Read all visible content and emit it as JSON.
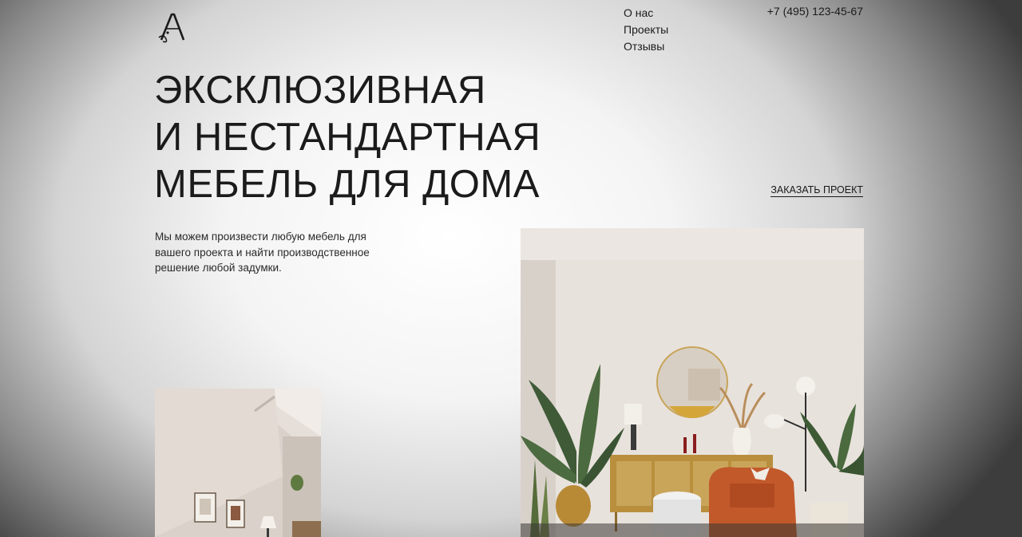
{
  "logo": {
    "letter": "A",
    "icon": "logo-monogram"
  },
  "nav": {
    "items": [
      "О нас",
      "Проекты",
      "Отзывы"
    ]
  },
  "header": {
    "phone": "+7 (495) 123-45-67"
  },
  "hero": {
    "title_lines": [
      "ЭКСКЛЮЗИВНАЯ",
      "И НЕСТАНДАРТНАЯ",
      "МЕБЕЛЬ ДЛЯ ДОМА"
    ],
    "cta_label": "ЗАКАЗАТЬ ПРОЕКТ",
    "description": "Мы можем произвести любую мебель для вашего проекта и найти производственное решение любой задумки."
  },
  "images": {
    "left": "interior-photo-hallway",
    "main": "interior-photo-living-room"
  },
  "colors": {
    "text": "#1b1b1b",
    "wall": "#e8e2dc",
    "armchair": "#c2592b",
    "sideboard": "#b98f3e",
    "plant": "#3f5a37"
  }
}
